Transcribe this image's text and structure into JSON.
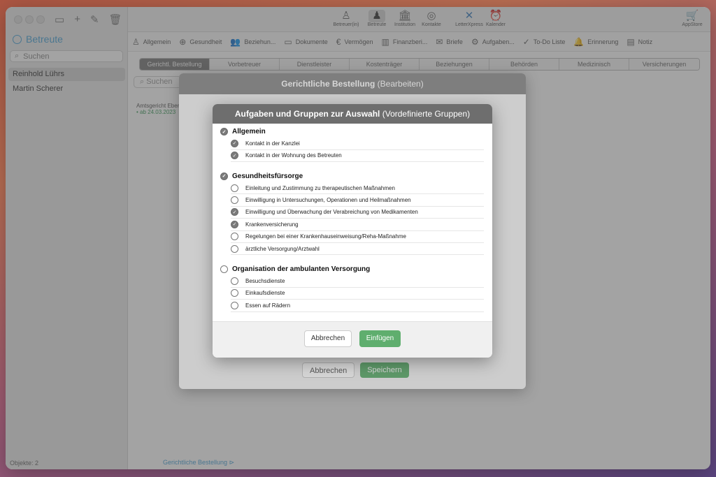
{
  "sidebar": {
    "title": "Betreute",
    "search_placeholder": "Suchen",
    "items": [
      "Reinhold Lührs",
      "Martin Scherer"
    ],
    "footer_label": "Objekte:",
    "footer_count": "2"
  },
  "toolbar": {
    "buttons": [
      {
        "label": "Betreuer(in)",
        "icon": "person-outline-icon"
      },
      {
        "label": "Betreute",
        "icon": "person-filled-icon"
      },
      {
        "label": "Institution",
        "icon": "building-icon"
      },
      {
        "label": "Kontakte",
        "icon": "contacts-icon"
      },
      {
        "label": "LetterXpress",
        "icon": "letterxpress-icon"
      },
      {
        "label": "Kalender",
        "icon": "alarm-clock-icon"
      }
    ],
    "appstore": "AppStore"
  },
  "tabs": [
    "Allgemein",
    "Gesundheit",
    "Beziehun...",
    "Dokumente",
    "Vermögen",
    "Finanzberi...",
    "Briefe",
    "Aufgaben...",
    "To-Do Liste",
    "Erinnerung",
    "Notiz"
  ],
  "segments": [
    "Gerichtl. Bestellung",
    "Vorbetreuer",
    "Dienstleister",
    "Kostenträger",
    "Beziehungen",
    "Behörden",
    "Medizinisch",
    "Versicherungen"
  ],
  "middle": {
    "search_placeholder": "Suchen",
    "entry_title": "Amtsgericht Ebers",
    "entry_sub": "• ab 24.03.2023",
    "footer": "Gerichtliche Bestellung"
  },
  "sheet": {
    "title": "Gerichtliche Bestellung",
    "subtitle": "(Bearbeiten)",
    "cancel": "Abbrechen",
    "save": "Speichern"
  },
  "dialog": {
    "title": "Aufgaben und Gruppen zur Auswahl",
    "subtitle": "(Vordefinierte Gruppen)",
    "groups": [
      {
        "name": "Allgemein",
        "checked": true,
        "items": [
          {
            "label": "Kontakt in der Kanzlei",
            "checked": true
          },
          {
            "label": "Kontakt in der Wohnung des Betreuten",
            "checked": true
          }
        ]
      },
      {
        "name": "Gesundheitsfürsorge",
        "checked": true,
        "items": [
          {
            "label": "Einleitung und Zustimmung zu therapeutischen Maßnahmen",
            "checked": false
          },
          {
            "label": "Einwilligung in Untersuchungen, Operationen und Heilmaßnahmen",
            "checked": false
          },
          {
            "label": "Einwilligung und Überwachung der Verabreichung von Medikamenten",
            "checked": true
          },
          {
            "label": "Krankenversicherung",
            "checked": true
          },
          {
            "label": "Regelungen bei einer Krankenhauseinweisung/Reha-Maßnahme",
            "checked": false
          },
          {
            "label": "ärztliche Versorgung/Arztwahl",
            "checked": false
          }
        ]
      },
      {
        "name": "Organisation der ambulanten Versorgung",
        "checked": false,
        "items": [
          {
            "label": "Besuchsdienste",
            "checked": false
          },
          {
            "label": "Einkaufsdienste",
            "checked": false
          },
          {
            "label": "Essen auf Rädern",
            "checked": false
          }
        ]
      }
    ],
    "cancel": "Abbrechen",
    "confirm": "Einfügen"
  }
}
